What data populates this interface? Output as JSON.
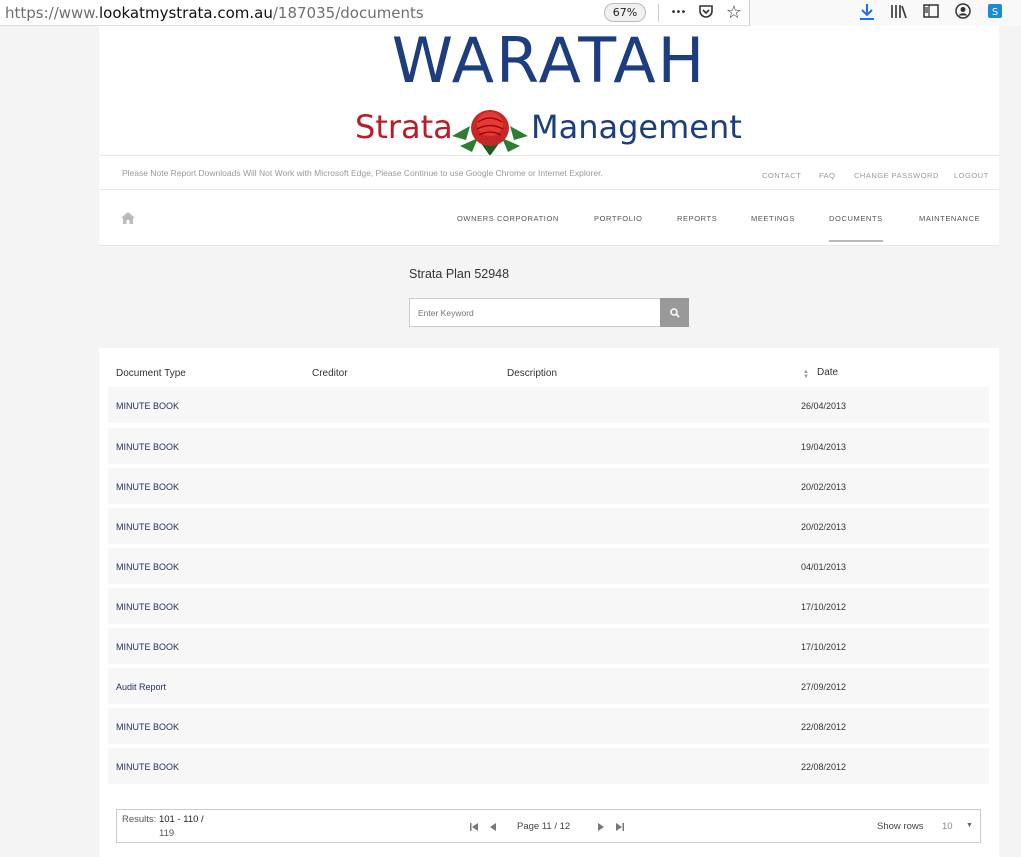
{
  "browser": {
    "url_prefix": "https://www.",
    "url_host": "lookatmystrata.com.au",
    "url_path": "/187035/documents",
    "zoom": "67%",
    "more_icon": "•••",
    "pocket_icon": "pocket-icon",
    "star_icon": "☆",
    "download_icon": "download-icon",
    "library_icon": "library-icon",
    "sidebar_icon": "sidebar-icon",
    "account_icon": "account-icon",
    "extension_icon": "extension-icon"
  },
  "logo": {
    "top": "WARATAH",
    "left": "Strata",
    "right": "Management"
  },
  "notice": "Please Note Report Downloads Will Not Work with Microsoft Edge, Please Continue to use Google Chrome or Internet Explorer.",
  "top_links": [
    "CONTACT",
    "FAQ",
    "CHANGE PASSWORD",
    "LOGOUT"
  ],
  "nav": {
    "items": [
      "OWNERS CORPORATION",
      "PORTFOLIO",
      "REPORTS",
      "MEETINGS",
      "DOCUMENTS",
      "MAINTENANCE"
    ],
    "active": "DOCUMENTS"
  },
  "search": {
    "title": "Strata Plan 52948",
    "placeholder": "Enter Keyword"
  },
  "table": {
    "headers": [
      "Document Type",
      "Creditor",
      "Description",
      "Date"
    ],
    "rows": [
      {
        "type": "MINUTE BOOK",
        "creditor": "",
        "description": "",
        "date": "26/04/2013"
      },
      {
        "type": "MINUTE BOOK",
        "creditor": "",
        "description": "",
        "date": "19/04/2013"
      },
      {
        "type": "MINUTE BOOK",
        "creditor": "",
        "description": "",
        "date": "20/02/2013"
      },
      {
        "type": "MINUTE BOOK",
        "creditor": "",
        "description": "",
        "date": "20/02/2013"
      },
      {
        "type": "MINUTE BOOK",
        "creditor": "",
        "description": "",
        "date": "04/01/2013"
      },
      {
        "type": "MINUTE BOOK",
        "creditor": "",
        "description": "",
        "date": "17/10/2012"
      },
      {
        "type": "MINUTE BOOK",
        "creditor": "",
        "description": "",
        "date": "17/10/2012"
      },
      {
        "type": "Audit Report",
        "creditor": "",
        "description": "",
        "date": "27/09/2012"
      },
      {
        "type": "MINUTE BOOK",
        "creditor": "",
        "description": "",
        "date": "22/08/2012"
      },
      {
        "type": "MINUTE BOOK",
        "creditor": "",
        "description": "",
        "date": "22/08/2012"
      }
    ]
  },
  "pager": {
    "results_label": "Results:",
    "results_range": "101 - 110 /",
    "results_total": "119",
    "page_label": "Page",
    "page_value": "11 / 12",
    "show_rows_label": "Show rows",
    "rows_value": "10"
  },
  "colors": {
    "brand_blue": "#1c3d7e",
    "brand_red": "#b71e2a",
    "link_navy": "#1f2f5a"
  }
}
